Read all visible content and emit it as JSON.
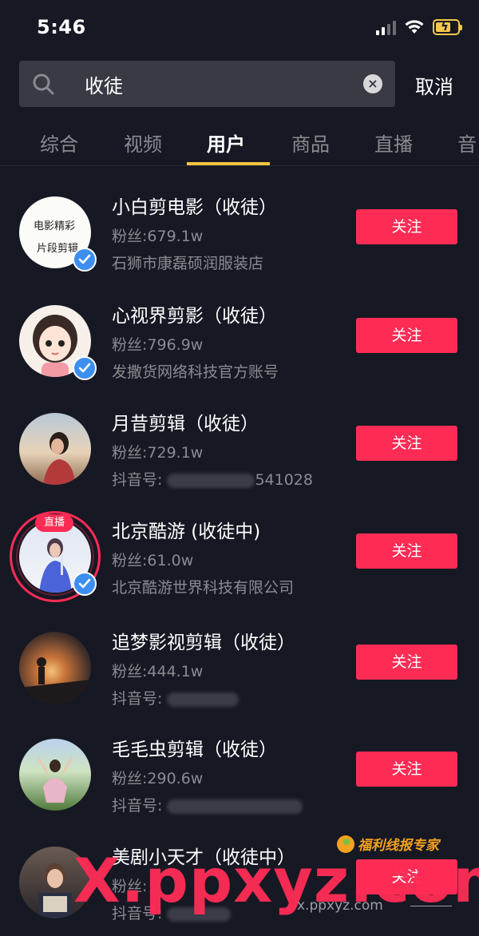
{
  "status_bar": {
    "time": "5:46"
  },
  "search": {
    "query": "收徒",
    "cancel_label": "取消"
  },
  "tabs": [
    {
      "label": "综合"
    },
    {
      "label": "视频"
    },
    {
      "label": "用户"
    },
    {
      "label": "商品"
    },
    {
      "label": "直播"
    },
    {
      "label": "音"
    }
  ],
  "active_tab": "用户",
  "users": [
    {
      "name": "小白剪电影（收徒）",
      "fans": "粉丝:679.1w",
      "desc": "石狮市康磊硕润服装店",
      "follow_label": "关注",
      "verified": true
    },
    {
      "name": "心视界剪影（收徒）",
      "fans": "粉丝:796.9w",
      "desc": "发撒货网络科技官方账号",
      "follow_label": "关注",
      "verified": true
    },
    {
      "name": "月昔剪辑（收徒）",
      "fans": "粉丝:729.1w",
      "desc_prefix": "抖音号: ",
      "desc_suffix": "541028",
      "follow_label": "关注",
      "verified": false
    },
    {
      "name": "北京酷游 (收徒中)",
      "fans": "粉丝:61.0w",
      "desc": "北京酷游世界科技有限公司",
      "follow_label": "关注",
      "verified": true,
      "live_label": "直播"
    },
    {
      "name": "追梦影视剪辑（收徒）",
      "fans": "粉丝:444.1w",
      "desc_prefix": "抖音号: ",
      "follow_label": "关注",
      "verified": false
    },
    {
      "name": "毛毛虫剪辑（收徒）",
      "fans": "粉丝:290.6w",
      "desc_prefix": "抖音号: ",
      "follow_label": "关注",
      "verified": false
    },
    {
      "name": "美剧小天才（收徒中）",
      "fans": "粉丝:",
      "desc_prefix": "抖音号: ",
      "follow_label": "关注",
      "verified": false
    }
  ],
  "avatar1_text": [
    "电影精彩",
    "片段剪辑"
  ],
  "watermark": {
    "brand": "福利线报专家",
    "big": "X.ppxyz.com",
    "small": "x.ppxyz.com"
  },
  "colors": {
    "background": "#161823",
    "follow_button": "#fe2c55",
    "tab_indicator": "#f9c33e",
    "verified_badge": "#3c8ff0"
  },
  "icons": [
    "search-icon",
    "clear-icon",
    "wifi-icon",
    "signal-icon",
    "battery-icon",
    "verified-icon"
  ]
}
